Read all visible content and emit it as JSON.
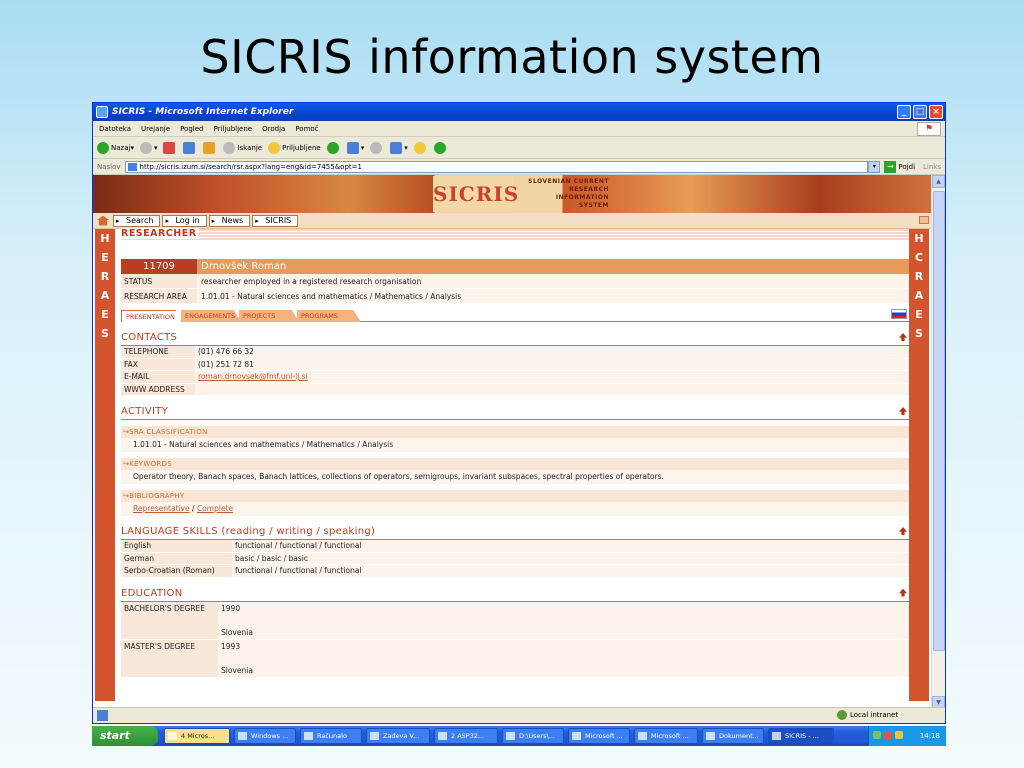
{
  "slide_title": "SICRIS information system",
  "window": {
    "title": "SICRIS - Microsoft Internet Explorer",
    "menu": [
      "Datoteka",
      "Urejanje",
      "Pogled",
      "Priljubljene",
      "Orodja",
      "Pomoč"
    ],
    "toolbar": {
      "back": "Nazaj",
      "search": "Iskanje",
      "favorites": "Priljubljene"
    },
    "address": {
      "label": "Naslov",
      "url": "http://sicris.izum.si/search/rsr.aspx?lang=eng&id=7455&opt=1",
      "go": "Pojdi",
      "links": "Links"
    }
  },
  "banner": {
    "logo": "SICRIS",
    "title_lines": [
      "SLOVENIAN CURRENT",
      "RESEARCH",
      "INFORMATION",
      "SYSTEM"
    ]
  },
  "nav": [
    "Search",
    "Log in",
    "News",
    "SICRIS"
  ],
  "sidebar_letters": [
    "S",
    "E",
    "A",
    "R",
    "C",
    "H"
  ],
  "researcher": {
    "heading": "RESEARCHER",
    "id": "11709",
    "name": "Drnovšek Roman",
    "status_label": "STATUS",
    "status": "researcher employed in a registered research organisation",
    "area_label": "RESEARCH AREA",
    "area": "1.01.01 - Natural sciences and mathematics / Mathematics / Analysis"
  },
  "tabs": [
    "Presentation",
    "Engagements",
    "Projects",
    "Programs"
  ],
  "contacts": {
    "title": "CONTACTS",
    "rows": [
      {
        "k": "TELEPHONE",
        "v": "(01) 476 66 32"
      },
      {
        "k": "FAX",
        "v": "(01) 251 72 81"
      },
      {
        "k": "E-MAIL",
        "v": "roman.drnovsek@fmf.uni-lj.si"
      },
      {
        "k": "WWW ADDRESS",
        "v": ""
      }
    ]
  },
  "activity": {
    "title": "ACTIVITY",
    "sra_head": "↪SRA CLASSIFICATION",
    "sra": "1.01.01 - Natural sciences and mathematics / Mathematics / Analysis",
    "kw_head": "↪KEYWORDS",
    "keywords": "Operator theory, Banach spaces, Banach lattices, collections of operators, semigroups, invariant subspaces, spectral properties of operators.",
    "bib_head": "↪BIBLIOGRAPHY",
    "bib_rep": "Representative",
    "bib_sep": " / ",
    "bib_complete": "Complete"
  },
  "languages": {
    "title": "LANGUAGE SKILLS (reading / writing / speaking)",
    "rows": [
      {
        "k": "English",
        "v": "functional / functional / functional"
      },
      {
        "k": "German",
        "v": "basic / basic / basic"
      },
      {
        "k": "Serbo-Croatian (Roman)",
        "v": "functional / functional / functional"
      }
    ]
  },
  "education": {
    "title": "EDUCATION",
    "rows": [
      {
        "k": "BACHELOR'S DEGREE",
        "year": "1990",
        "country": "Slovenia"
      },
      {
        "k": "MASTER'S DEGREE",
        "year": "1993",
        "country": "Slovenia"
      }
    ]
  },
  "status_bar": {
    "zone": "Local intranet"
  },
  "taskbar": {
    "start": "start",
    "items": [
      "4 Micros...",
      "Windows ...",
      "Računalo",
      "Zadeva V...",
      "2 ASP32...",
      "D:\\Users\\...",
      "Microsoft ...",
      "Microsoft ...",
      "Dokument...",
      "SICRIS - ..."
    ],
    "clock": "14:18"
  }
}
